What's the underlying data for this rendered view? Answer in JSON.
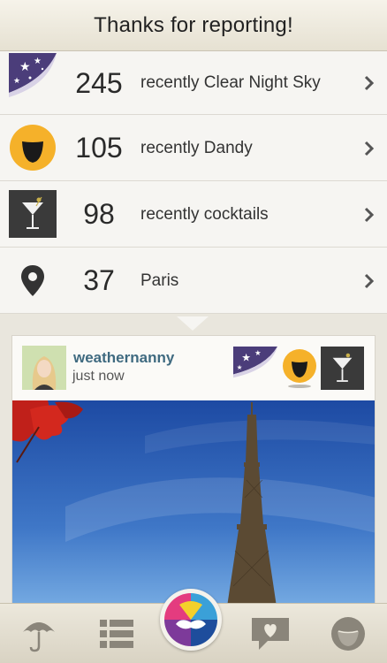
{
  "header": {
    "title": "Thanks for reporting!"
  },
  "reports": [
    {
      "icon": "clear-night-sky-icon",
      "count": "245",
      "label": "recently Clear Night Sky"
    },
    {
      "icon": "dandy-smiley-icon",
      "count": "105",
      "label": "recently Dandy"
    },
    {
      "icon": "cocktail-icon",
      "count": "98",
      "label": "recently cocktails"
    },
    {
      "icon": "location-pin-icon",
      "count": "37",
      "label": "Paris"
    }
  ],
  "post": {
    "username": "weathernanny",
    "timestamp": "just now",
    "tags": [
      "clear-night-sky-icon",
      "dandy-smiley-icon",
      "cocktail-icon"
    ],
    "photo": "eiffel-tower-photo"
  },
  "tabbar": {
    "tabs": [
      "umbrella-icon",
      "list-icon",
      "report-icon",
      "comment-heart-icon",
      "smiley-icon"
    ]
  },
  "colors": {
    "username": "#3f6a80",
    "dandy": "#f5b12a",
    "background": "#e9e6dd"
  }
}
